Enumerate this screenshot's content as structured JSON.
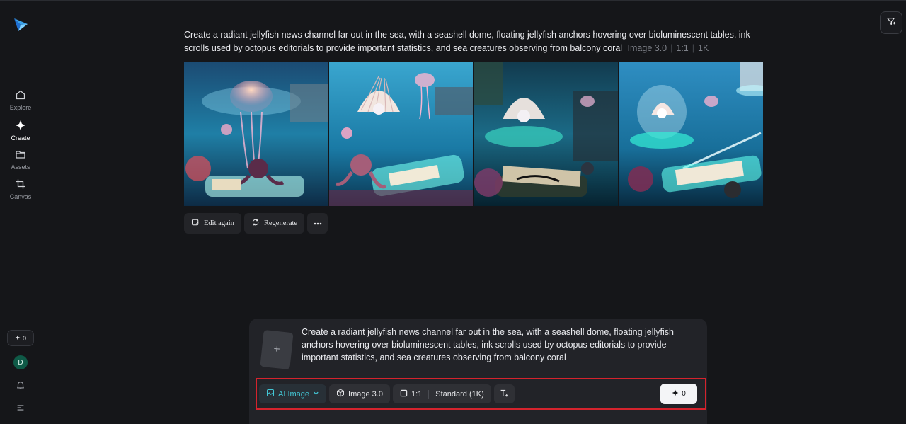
{
  "sidebar": {
    "items": [
      {
        "label": "Explore",
        "icon": "home-icon"
      },
      {
        "label": "Create",
        "icon": "sparkle-icon"
      },
      {
        "label": "Assets",
        "icon": "folder-icon"
      },
      {
        "label": "Canvas",
        "icon": "crop-icon"
      }
    ],
    "credits": "0",
    "avatar_initial": "D"
  },
  "result": {
    "prompt": "Create a radiant jellyfish news channel far out in the sea, with a seashell dome, floating jellyfish anchors hovering over bioluminescent tables, ink scrolls used by octopus editorials to provide important statistics, and sea creatures observing from balcony coral",
    "model": "Image 3.0",
    "ratio": "1:1",
    "resolution": "1K",
    "actions": {
      "edit_again": "Edit again",
      "regenerate": "Regenerate"
    }
  },
  "composer": {
    "text": "Create a radiant jellyfish news channel far out in the sea, with a seashell dome, floating jellyfish anchors hovering over bioluminescent tables, ink scrolls used by octopus editorials to provide important statistics, and sea creatures observing from balcony coral",
    "mode": "AI Image",
    "model": "Image 3.0",
    "ratio": "1:1",
    "quality": "Standard (1K)",
    "generate_cost": "0"
  },
  "colors": {
    "background": "#151619",
    "accent": "#43c7d6",
    "highlight_border": "#d5232d"
  }
}
